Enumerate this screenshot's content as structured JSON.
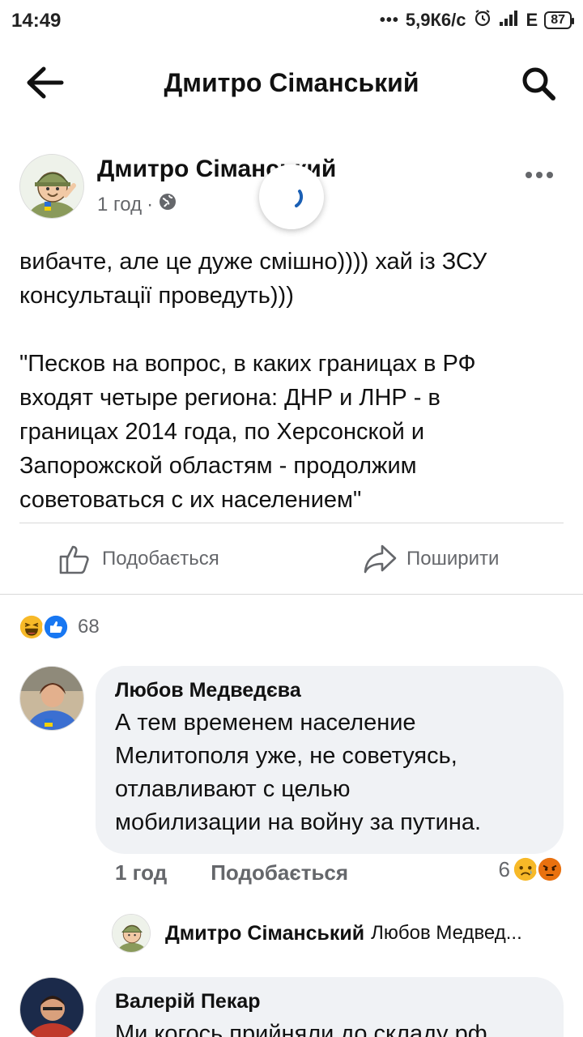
{
  "status_bar": {
    "time": "14:49",
    "dots": "•••",
    "network_speed": "5,9К6/с",
    "network_type": "E",
    "battery": "87"
  },
  "header": {
    "title": "Дмитро Сіманський"
  },
  "post": {
    "author": "Дмитро Сіманський",
    "time": "1 год",
    "separator": "·",
    "text_lines": [
      "вибачте, але це дуже смішно)))) хай із ЗСУ",
      "консультації проведуть)))",
      "\"Песков на вопрос, в каких границах в РФ",
      "входят четыре региона: ДНР и ЛНР - в",
      "границах 2014 года, по Херсонской и",
      "Запорожской областям - продолжим",
      "советоваться с их населением\""
    ],
    "like_label": "Подобається",
    "share_label": "Поширити",
    "reaction_count": "68"
  },
  "comments": [
    {
      "author": "Любов Медведєва",
      "text_lines": [
        "А тем временем население",
        "Мелитополя уже, не советуясь,",
        "отлавливают с целью",
        "мобилизации на войну за путина."
      ],
      "time": "1 год",
      "like_label": "Подобається",
      "reaction_count": "6"
    },
    {
      "author": "Валерій Пекар",
      "text_partial": "Ми когось прийняли до складу рф"
    }
  ],
  "reply": {
    "author": "Дмитро Сіманський",
    "text": "Любов Медвед..."
  },
  "colors": {
    "secondary_text": "#65676b",
    "bubble_bg": "#f0f2f5",
    "like_blue": "#1877f2",
    "haha_yellow": "#f7b928",
    "angry_orange": "#e9710f"
  }
}
